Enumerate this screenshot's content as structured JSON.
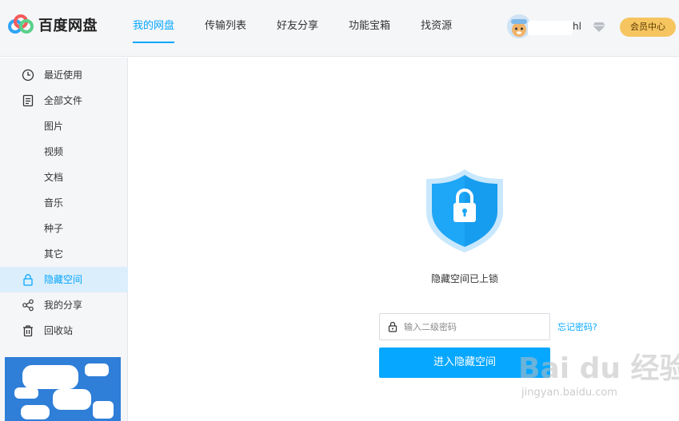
{
  "app": {
    "logo_text": "百度网盘",
    "accent_color": "#06a7ff",
    "vip_color": "#f6c560"
  },
  "nav": {
    "tabs": [
      {
        "label": "我的网盘",
        "active": true
      },
      {
        "label": "传输列表",
        "active": false
      },
      {
        "label": "好友分享",
        "active": false
      },
      {
        "label": "功能宝箱",
        "active": false
      },
      {
        "label": "找资源",
        "active": false
      }
    ]
  },
  "user": {
    "name_suffix": "hl",
    "vip_label": "会员中心"
  },
  "sidebar": {
    "items": [
      {
        "label": "最近使用",
        "icon": "clock-icon"
      },
      {
        "label": "全部文件",
        "icon": "document-icon"
      },
      {
        "label": "图片",
        "icon": ""
      },
      {
        "label": "视频",
        "icon": ""
      },
      {
        "label": "文档",
        "icon": ""
      },
      {
        "label": "音乐",
        "icon": ""
      },
      {
        "label": "种子",
        "icon": ""
      },
      {
        "label": "其它",
        "icon": ""
      },
      {
        "label": "隐藏空间",
        "icon": "lock-icon",
        "active": true
      },
      {
        "label": "我的分享",
        "icon": "share-icon"
      },
      {
        "label": "回收站",
        "icon": "trash-icon"
      }
    ]
  },
  "hidden_space": {
    "locked_text": "隐藏空间已上锁",
    "password_placeholder": "输入二级密码",
    "forgot_label": "忘记密码?",
    "enter_button": "进入隐藏空间"
  },
  "watermark": {
    "brand": "Bai du 经验",
    "url": "jingyan.baidu.com"
  }
}
